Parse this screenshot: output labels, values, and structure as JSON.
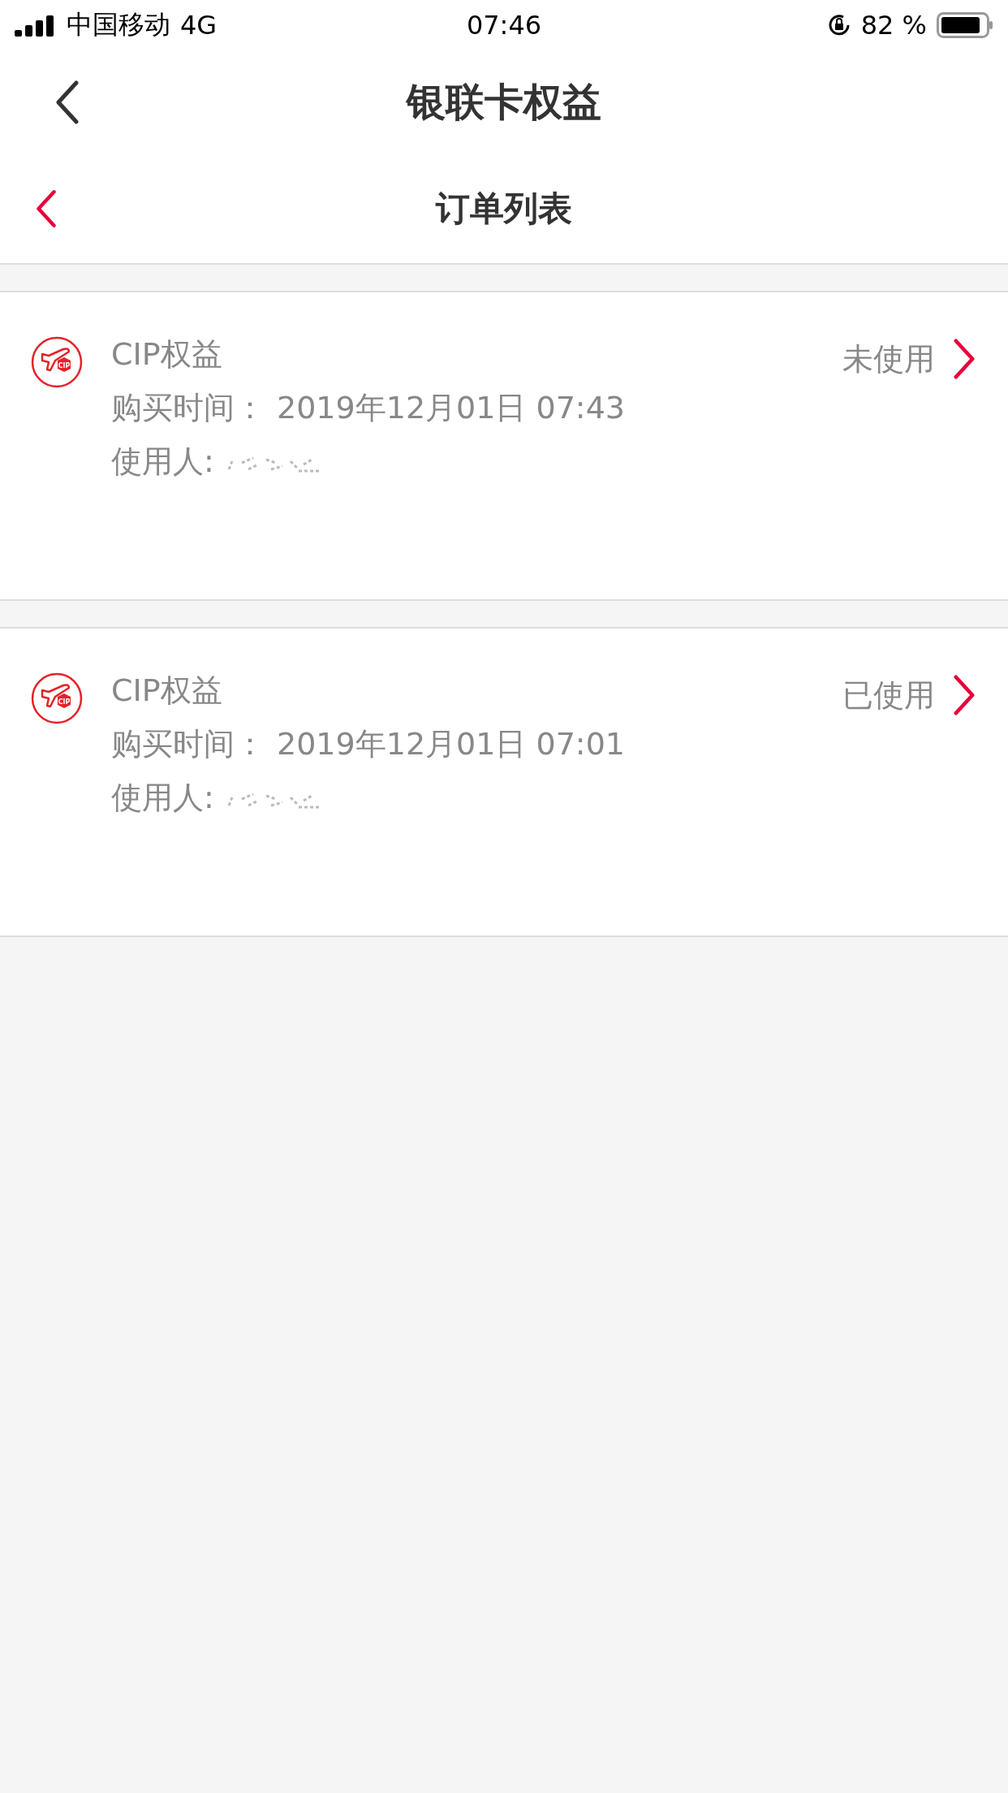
{
  "status_bar": {
    "carrier": "中国移动",
    "network": "4G",
    "time": "07:46",
    "battery": "82 %"
  },
  "nav_bar": {
    "title": "银联卡权益"
  },
  "sub_header": {
    "title": "订单列表"
  },
  "orders": [
    {
      "badge": "CIP",
      "title": "CIP权益",
      "purchase_label": "购买时间：",
      "purchase_time": "2019年12月01日 07:43",
      "user_label": "使用人:",
      "status": "未使用"
    },
    {
      "badge": "CIP",
      "title": "CIP权益",
      "purchase_label": "购买时间：",
      "purchase_time": "2019年12月01日 07:01",
      "user_label": "使用人:",
      "status": "已使用"
    }
  ]
}
